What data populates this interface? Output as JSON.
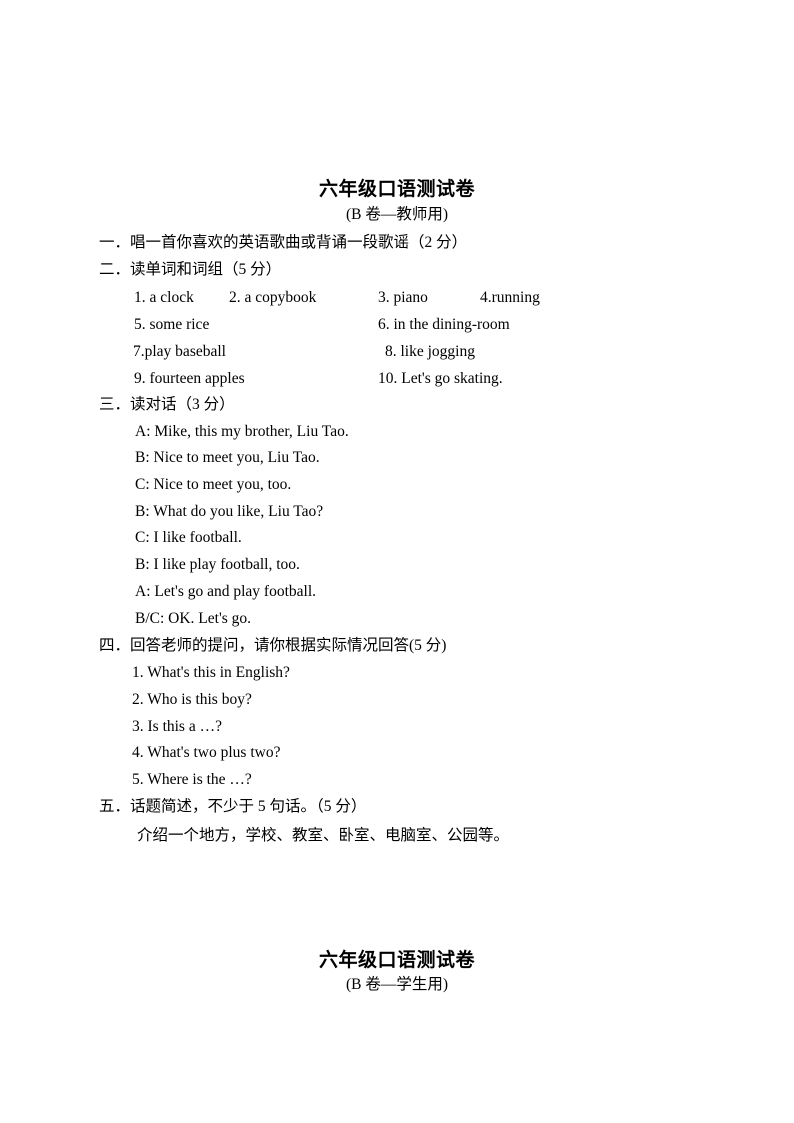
{
  "document": {
    "title_top": "六年级口语测试卷",
    "subtitle_top": "(B 卷—教师用)",
    "title_bottom": "六年级口语测试卷",
    "subtitle_bottom": "(B 卷—学生用)"
  },
  "sections": {
    "one": {
      "marker": "一．",
      "heading": "唱一首你喜欢的英语歌曲或背诵一段歌谣（2 分）"
    },
    "two": {
      "marker": "二．",
      "heading": "读单词和词组（5 分）",
      "words": {
        "w1": "1. a clock",
        "w2": "2. a copybook",
        "w3": "3. piano",
        "w4": "4.running",
        "w5": "5. some rice",
        "w6": "6. in the dining-room",
        "w7": "7.play baseball",
        "w8": "8. like jogging",
        "w9": "9. fourteen apples",
        "w10": "10. Let's go skating."
      }
    },
    "three": {
      "marker": "三．",
      "heading": "读对话（3 分）",
      "dialogue": [
        "A: Mike, this my brother, Liu Tao.",
        "B: Nice to meet you, Liu Tao.",
        "C: Nice to meet you, too.",
        "B: What do you like, Liu Tao?",
        "C: I like football.",
        "B: I like play football, too.",
        "A: Let's go and play football.",
        "B/C: OK. Let's go."
      ]
    },
    "four": {
      "marker": "四．",
      "heading": "回答老师的提问，请你根据实际情况回答(5 分)",
      "questions": [
        "1. What's this in English?",
        "2. Who is this boy?",
        "3. Is this a  …?",
        "4. What's two plus two?",
        "5. Where is the  …?"
      ]
    },
    "five": {
      "marker": "五．",
      "heading": "话题简述，不少于 5 句话。（5 分）",
      "body": "介绍一个地方，学校、教室、卧室、电脑室、公园等。"
    }
  }
}
